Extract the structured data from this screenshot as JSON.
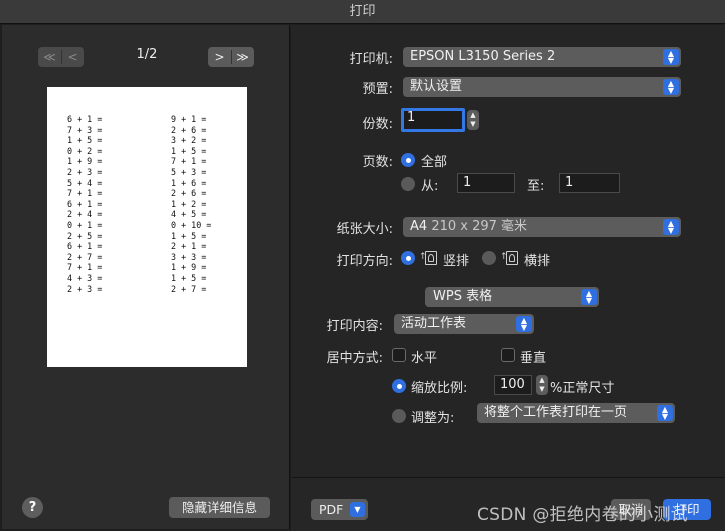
{
  "window": {
    "title": "打印"
  },
  "preview": {
    "page_indicator": "1/2",
    "nav_first": "≪",
    "nav_prev": "<",
    "nav_next": ">",
    "nav_last": "≫",
    "left_column": [
      "6 + 1 =",
      "7 + 3 =",
      "1 + 5 =",
      "0 + 2 =",
      "1 + 9 =",
      "2 + 3 =",
      "5 + 4 =",
      "7 + 1 =",
      "6 + 1 =",
      "2 + 4 =",
      "0 + 1 =",
      "2 + 5 =",
      "6 + 1 =",
      "2 + 7 =",
      "7 + 1 =",
      "4 + 3 =",
      "2 + 3 ="
    ],
    "right_column": [
      "9 + 1 =",
      "2 + 6 =",
      "3 + 2 =",
      "1 + 5 =",
      "7 + 1 =",
      "5 + 3 =",
      "1 + 6 =",
      "2 + 6 =",
      "1 + 2 =",
      "4 + 5 =",
      "0 + 10 =",
      "1 + 5 =",
      "2 + 1 =",
      "3 + 3 =",
      "1 + 9 =",
      "1 + 5 =",
      "2 + 7 ="
    ]
  },
  "left_footer": {
    "help": "?",
    "hide_details": "隐藏详细信息"
  },
  "printer": {
    "label": "打印机:",
    "value": "EPSON L3150 Series 2"
  },
  "preset": {
    "label": "预置:",
    "value": "默认设置"
  },
  "copies": {
    "label": "份数:",
    "value": "1"
  },
  "pages": {
    "label": "页数:",
    "all_label": "全部",
    "from_label": "从:",
    "from_value": "1",
    "to_label": "至:",
    "to_value": "1"
  },
  "paper_size": {
    "label": "纸张大小:",
    "value": "A4",
    "detail": "210 x 297 毫米"
  },
  "orientation": {
    "label": "打印方向:",
    "portrait": "竖排",
    "landscape": "横排"
  },
  "section_select": {
    "value": "WPS 表格"
  },
  "print_content": {
    "label": "打印内容:",
    "value": "活动工作表"
  },
  "centering": {
    "label": "居中方式:",
    "horizontal": "水平",
    "vertical": "垂直"
  },
  "scale": {
    "label": "缩放比例:",
    "value": "100",
    "suffix": "%正常尺寸"
  },
  "fit": {
    "label": "调整为:",
    "value": "将整个工作表打印在一页"
  },
  "footer": {
    "pdf": "PDF",
    "cancel": "取消",
    "print": "打印"
  },
  "watermark": "CSDN @拒绝内卷的小测试",
  "colors": {
    "accent": "#2f6fe0",
    "panel": "#252525",
    "control": "#5c5c5c"
  },
  "icons": [
    "chevron-updown-icon",
    "help-icon",
    "portrait-icon",
    "landscape-icon"
  ]
}
